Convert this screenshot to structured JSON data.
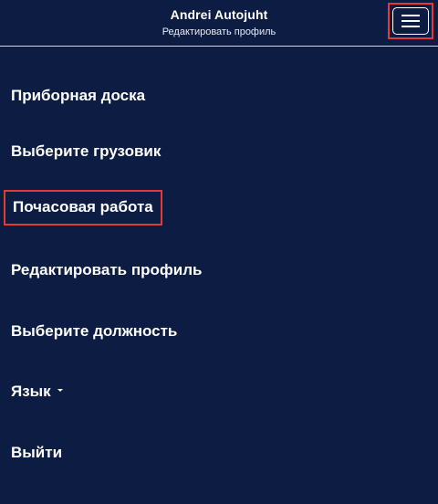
{
  "header": {
    "user_name": "Andrei Autojuht",
    "subtitle": "Редактировать профиль",
    "menu_icon": "hamburger-menu-icon"
  },
  "nav": {
    "dashboard": "Приборная доска",
    "select_truck": "Выберите грузовик",
    "hourly_work": "Почасовая работа",
    "edit_profile": "Редактировать профиль",
    "select_position": "Выберите должность",
    "language": "Язык",
    "logout": "Выйти"
  },
  "colors": {
    "background": "#0c1c43",
    "highlight": "#e53935",
    "text": "#ffffff"
  }
}
